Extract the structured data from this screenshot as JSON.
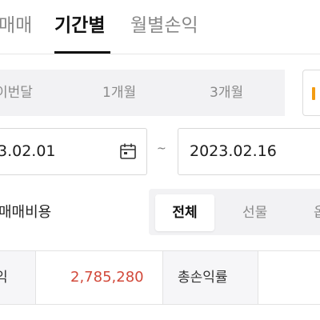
{
  "tabs": [
    {
      "label": "매매",
      "active": false
    },
    {
      "label": "기간별",
      "active": true
    },
    {
      "label": "월별손익",
      "active": false
    }
  ],
  "period_buttons": [
    {
      "label": "이번달"
    },
    {
      "label": "1개월"
    },
    {
      "label": "3개월"
    }
  ],
  "date_range": {
    "start": "3.02.01",
    "separator": "~",
    "end": "2023.02.16"
  },
  "icons": {
    "start_calendar": "calendar-icon",
    "quick_calendar": "calendar-icon"
  },
  "colors": {
    "accent": "#f39c12",
    "profit_value": "#d2493a"
  },
  "trading_cost_label": "매매비용",
  "segments": [
    {
      "label": "전체",
      "active": true
    },
    {
      "label": "선물",
      "active": false
    },
    {
      "label": "옵",
      "active": false
    }
  ],
  "summary": {
    "profit_label": "익",
    "profit_value": "2,785,280",
    "rate_label": "총손익률"
  }
}
